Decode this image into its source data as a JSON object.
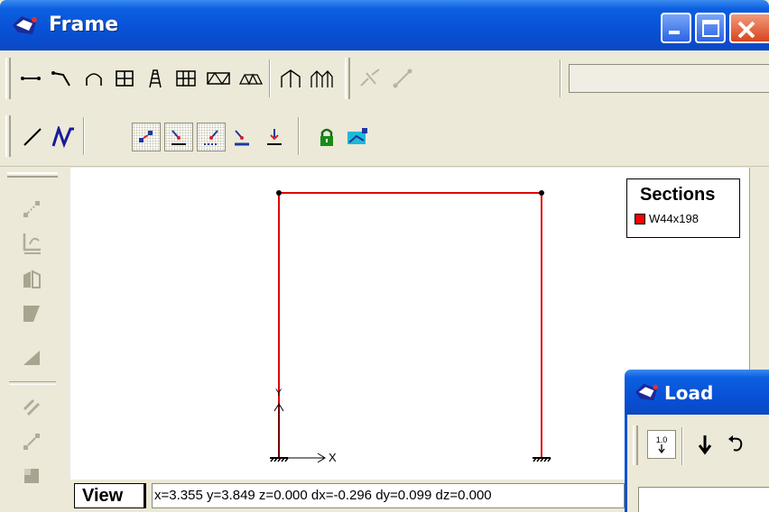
{
  "window": {
    "title": "Frame",
    "icon": "app-icon",
    "controls": [
      "minimize-icon",
      "maximize-icon",
      "close-icon"
    ]
  },
  "toolbar_top": {
    "tools": [
      "beam-tool-icon",
      "cantilever-tool-icon",
      "arch-tool-icon",
      "grid-frame-icon",
      "tower-icon",
      "multi-bay-frame-icon",
      "truss-icon",
      "bridge-truss-icon",
      "portal-frame-icon",
      "multi-portal-icon",
      "split-member-icon",
      "connect-nodes-icon"
    ],
    "combo_value": ""
  },
  "toolbar_second": {
    "tools": [
      "draw-line-icon",
      "draw-polyline-icon",
      "select-node-icon",
      "support-pinned-icon",
      "support-roller-icon",
      "support-fixed-icon",
      "support-spring-icon",
      "lock-icon",
      "snap-view-icon"
    ],
    "pressed": [
      "select-node-icon",
      "support-pinned-icon",
      "support-roller-icon"
    ]
  },
  "left_toolbar": {
    "tools": [
      "move-node-icon",
      "rotate-member-icon",
      "mirror-icon",
      "shear-icon",
      "slope-icon",
      "offset-icon",
      "extend-icon",
      "fill-icon"
    ]
  },
  "legend": {
    "title": "Sections",
    "items": [
      {
        "label": "W44x198",
        "color": "#ff0000"
      }
    ]
  },
  "axes": {
    "x_label": "X",
    "y_label": "Y"
  },
  "status": {
    "view_label": "View",
    "coordinates": "x=3.355 y=3.849 z=0.000 dx=-0.296 dy=0.099 dz=0.000"
  },
  "load_window": {
    "title": "Load",
    "load_value": "1.0"
  },
  "colors": {
    "member": "#e00000",
    "titlebar": "#0851d6",
    "face": "#ece9d8"
  }
}
